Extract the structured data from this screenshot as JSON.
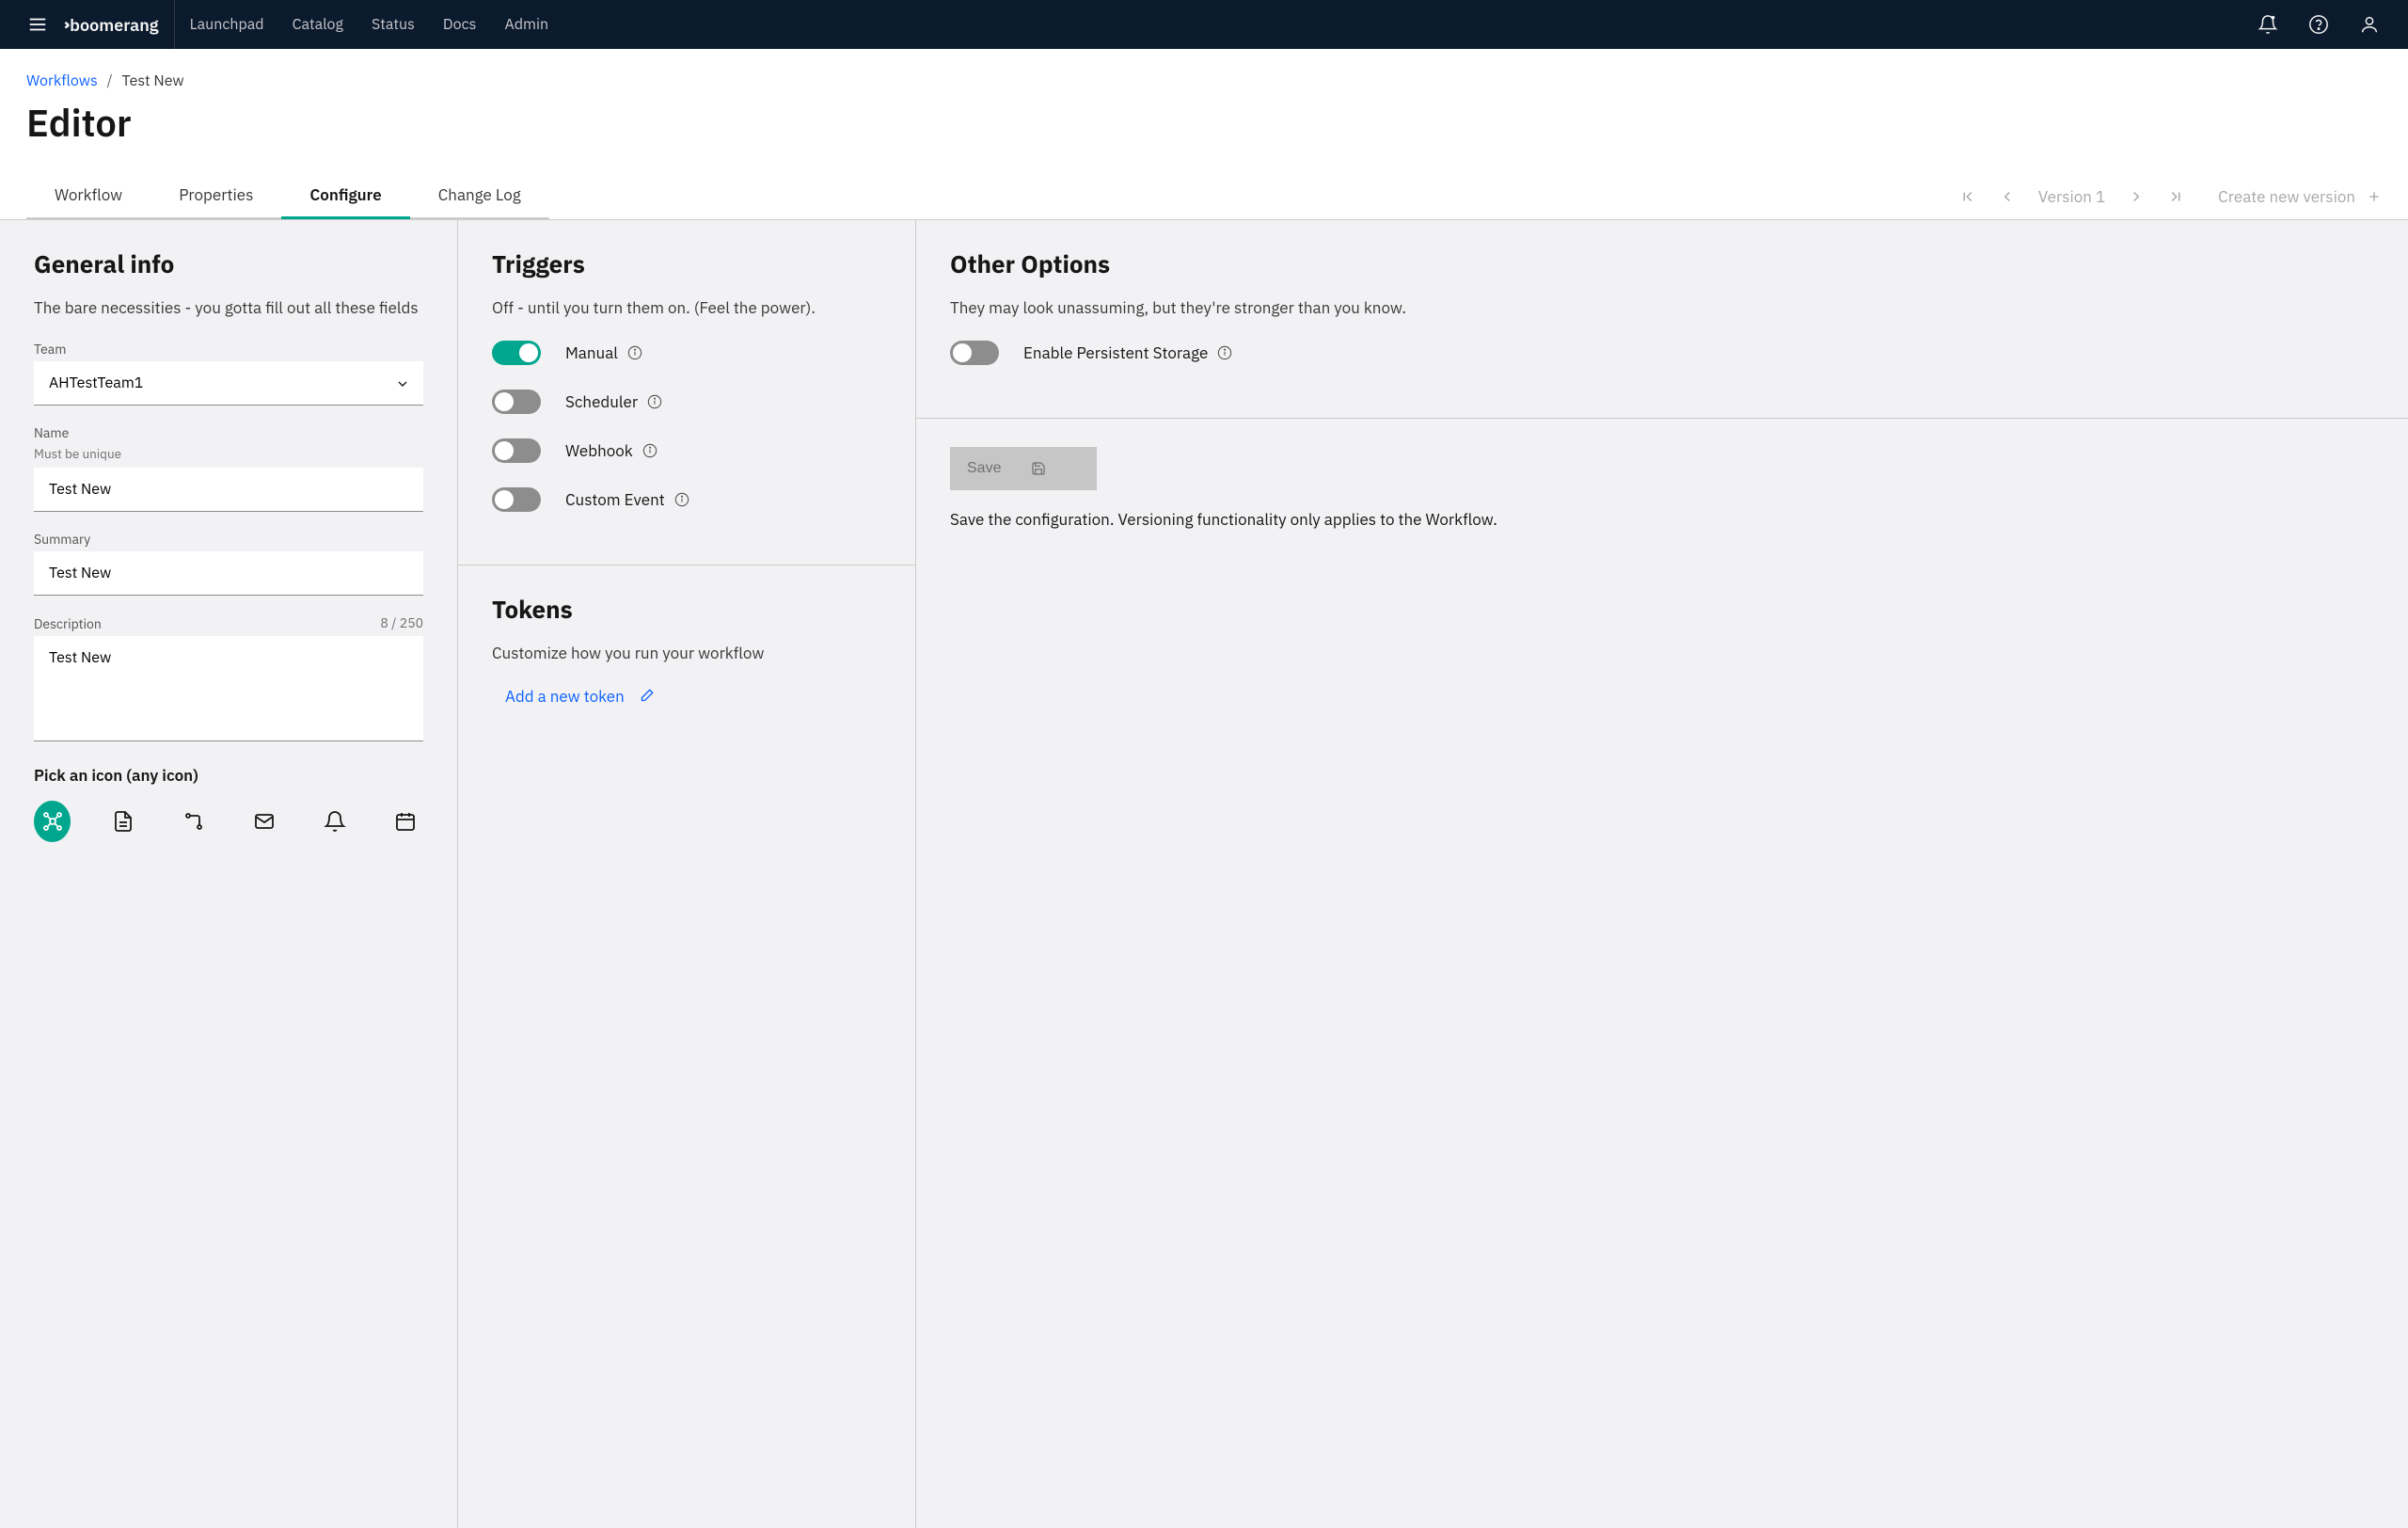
{
  "header": {
    "brand": "boomerang",
    "nav": [
      "Launchpad",
      "Catalog",
      "Status",
      "Docs",
      "Admin"
    ]
  },
  "breadcrumb": {
    "root": "Workflows",
    "current": "Test New"
  },
  "page_title": "Editor",
  "tabs": [
    "Workflow",
    "Properties",
    "Configure",
    "Change Log"
  ],
  "active_tab": "Configure",
  "version": {
    "label": "Version 1",
    "create": "Create new version"
  },
  "general": {
    "title": "General info",
    "sub": "The bare necessities - you gotta fill out all these fields",
    "team_label": "Team",
    "team_value": "AHTestTeam1",
    "name_label": "Name",
    "name_help": "Must be unique",
    "name_value": "Test New",
    "summary_label": "Summary",
    "summary_value": "Test New",
    "desc_label": "Description",
    "desc_counter": "8 / 250",
    "desc_value": "Test New",
    "icon_label": "Pick an icon (any icon)"
  },
  "triggers": {
    "title": "Triggers",
    "sub": "Off - until you turn them on. (Feel the power).",
    "items": [
      {
        "label": "Manual",
        "on": true
      },
      {
        "label": "Scheduler",
        "on": false
      },
      {
        "label": "Webhook",
        "on": false
      },
      {
        "label": "Custom Event",
        "on": false
      }
    ]
  },
  "tokens": {
    "title": "Tokens",
    "sub": "Customize how you run your workflow",
    "add": "Add a new token"
  },
  "other": {
    "title": "Other Options",
    "sub": "They may look unassuming, but they're stronger than you know.",
    "storage_label": "Enable Persistent Storage"
  },
  "save": {
    "button": "Save",
    "note": "Save the configuration. Versioning functionality only applies to the Workflow."
  }
}
